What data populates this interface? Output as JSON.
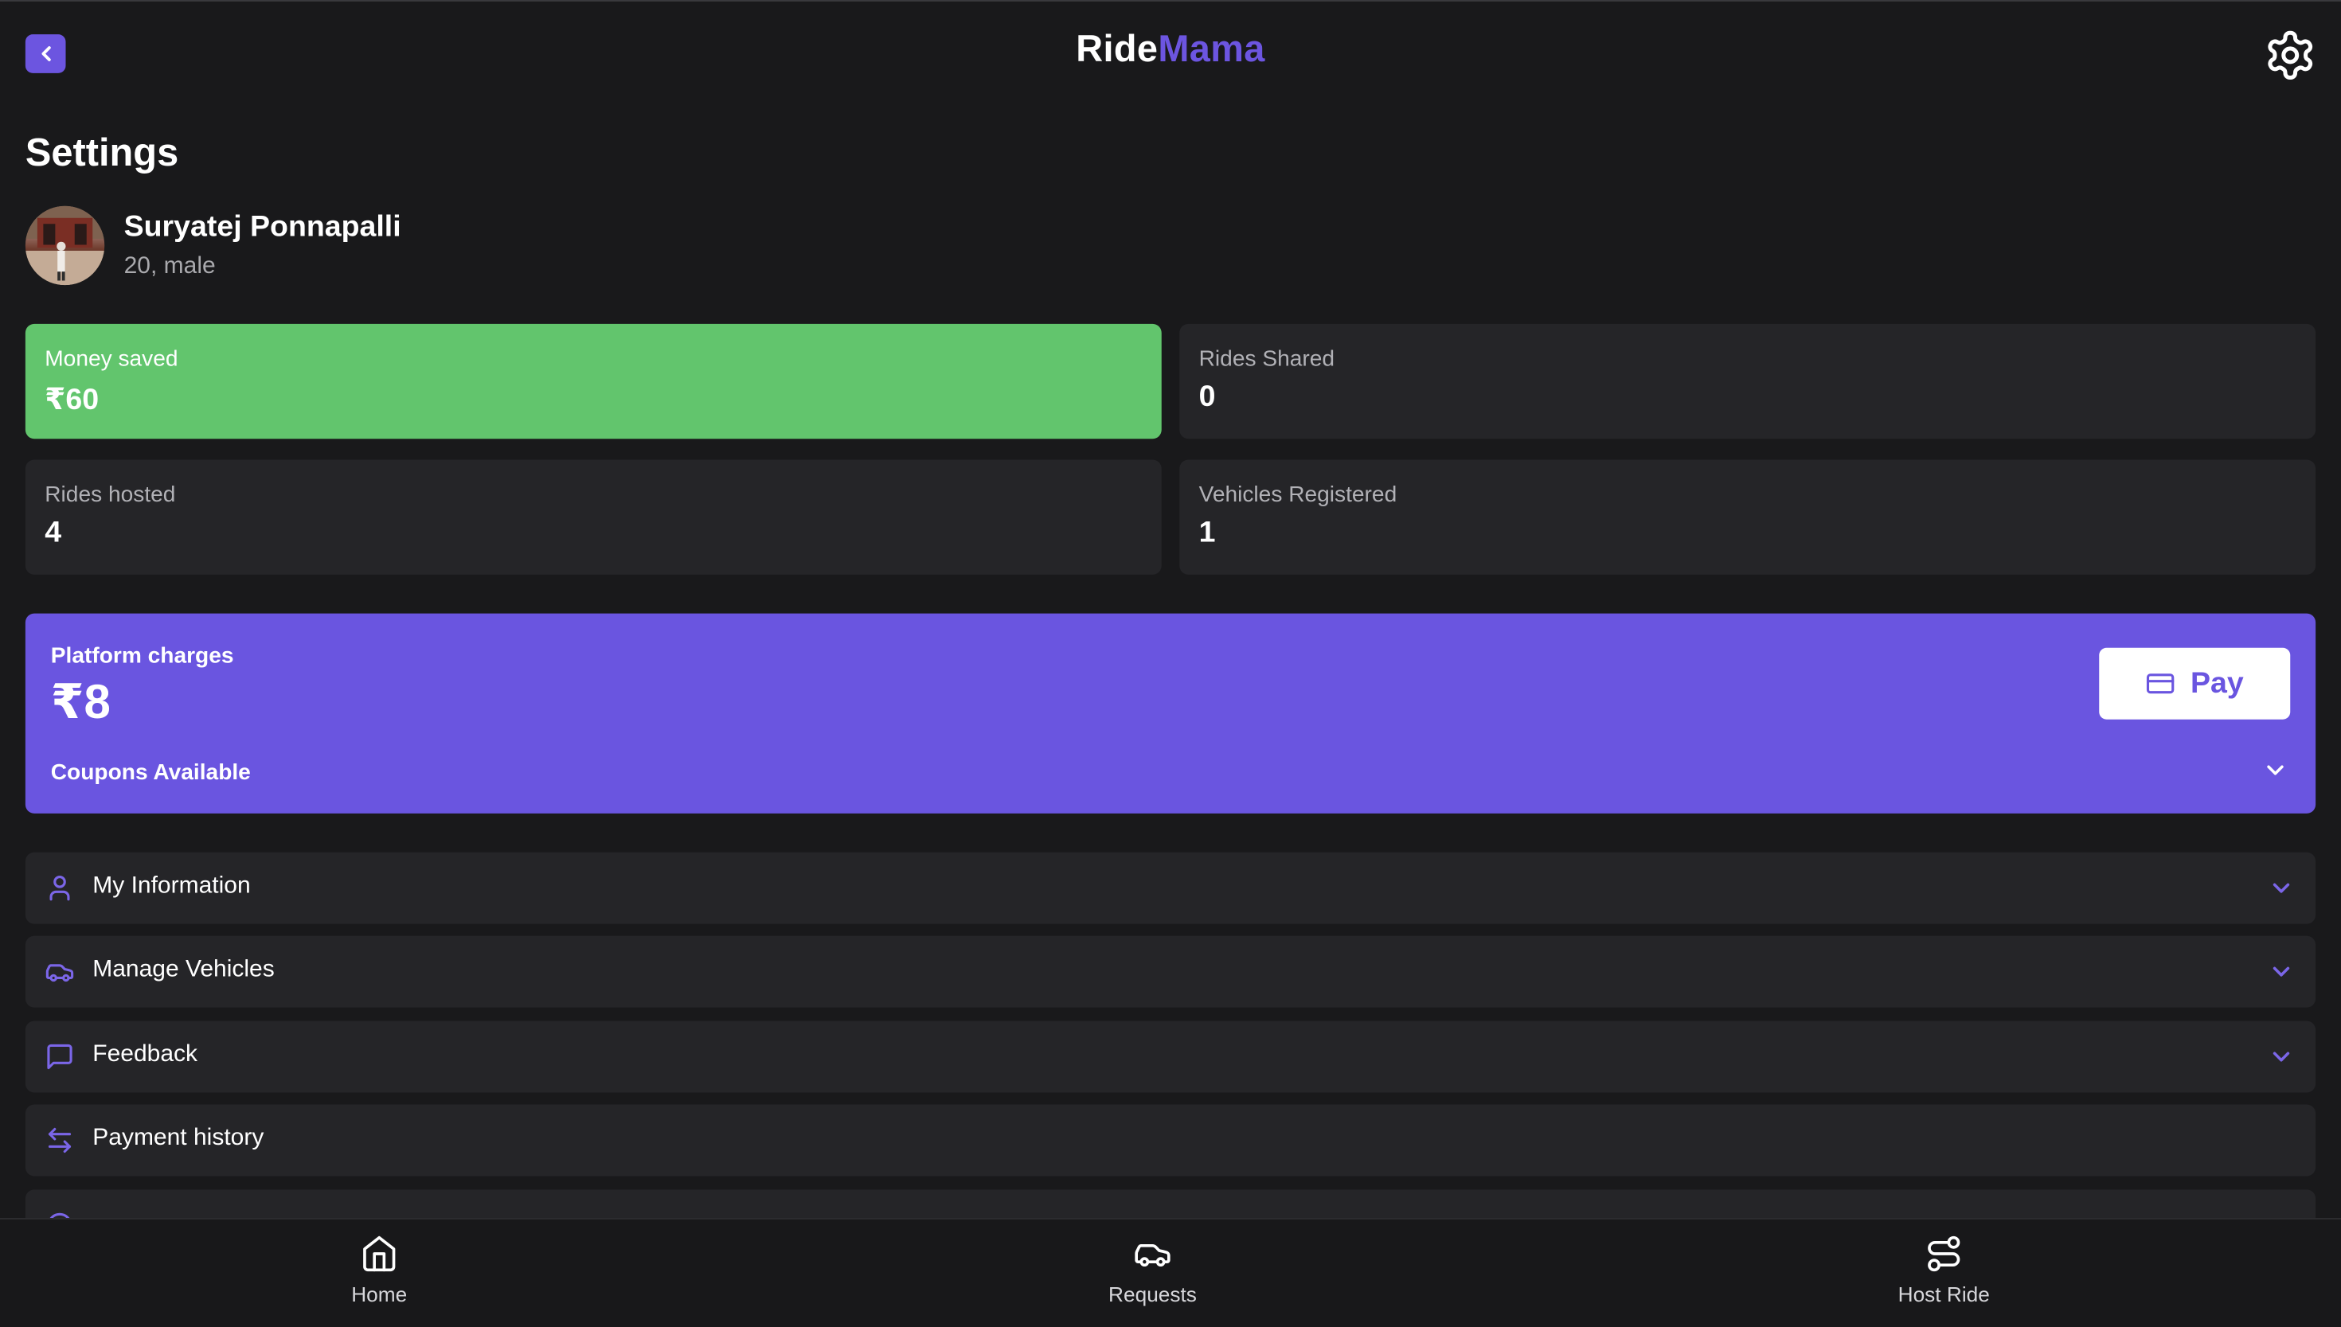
{
  "header": {
    "brand_part1": "Ride",
    "brand_part2": "Mama",
    "back_icon": "chevron-left-icon",
    "settings_icon": "gear-icon"
  },
  "page": {
    "title": "Settings"
  },
  "profile": {
    "name": "Suryatej Ponnapalli",
    "details": "20, male"
  },
  "stats": [
    {
      "label": "Money saved",
      "value": "₹60"
    },
    {
      "label": "Rides Shared",
      "value": "0"
    },
    {
      "label": "Rides hosted",
      "value": "4"
    },
    {
      "label": "Vehicles Registered",
      "value": "1"
    }
  ],
  "platform": {
    "label": "Platform charges",
    "amount": "₹8",
    "pay_label": "Pay",
    "coupons_label": "Coupons Available"
  },
  "menu": [
    {
      "label": "My Information",
      "icon": "user-icon"
    },
    {
      "label": "Manage Vehicles",
      "icon": "car-icon"
    },
    {
      "label": "Feedback",
      "icon": "message-square-icon"
    },
    {
      "label": "Payment history",
      "icon": "arrows-left-right-icon"
    }
  ],
  "bottom_nav": [
    {
      "label": "Home",
      "icon": "home-icon"
    },
    {
      "label": "Requests",
      "icon": "car-icon"
    },
    {
      "label": "Host Ride",
      "icon": "route-icon"
    }
  ],
  "colors": {
    "background": "#19191b",
    "card": "#252528",
    "accent": "#6a55e0",
    "success": "#62c56d"
  }
}
